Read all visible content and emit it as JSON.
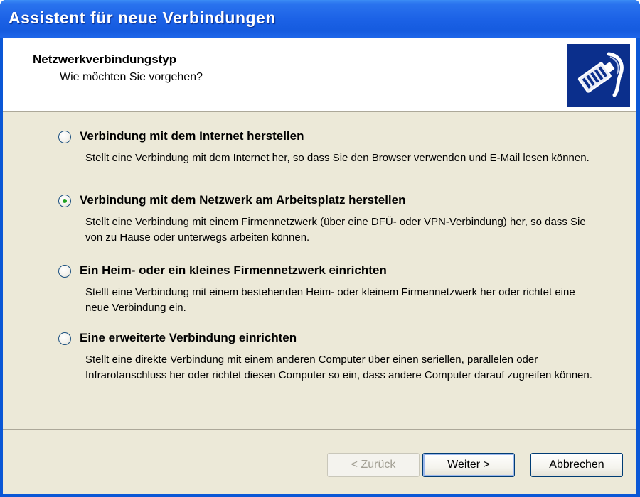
{
  "window": {
    "title": "Assistent für neue Verbindungen"
  },
  "header": {
    "title": "Netzwerkverbindungstyp",
    "subtitle": "Wie möchten Sie vorgehen?",
    "icon": "network-cable-icon"
  },
  "options": [
    {
      "label": "Verbindung mit dem Internet herstellen",
      "description": "Stellt eine Verbindung mit dem Internet her, so dass Sie den Browser verwenden und E-Mail lesen können.",
      "checked": false
    },
    {
      "label": "Verbindung mit dem Netzwerk am Arbeitsplatz herstellen",
      "description": "Stellt eine Verbindung mit einem Firmennetzwerk (über eine DFÜ- oder VPN-Verbindung) her, so dass Sie von zu Hause oder unterwegs arbeiten können.",
      "checked": true
    },
    {
      "label": "Ein Heim- oder ein kleines Firmennetzwerk einrichten",
      "description": "Stellt eine Verbindung mit einem bestehenden Heim- oder kleinem Firmennetzwerk her oder richtet eine neue Verbindung ein.",
      "checked": false
    },
    {
      "label": "Eine erweiterte Verbindung einrichten",
      "description": "Stellt eine direkte Verbindung mit einem anderen Computer über einen seriellen, parallelen oder Infrarotanschluss her oder richtet diesen Computer so ein, dass andere Computer darauf zugreifen können.",
      "checked": false
    }
  ],
  "buttons": {
    "back": "< Zurück",
    "next": "Weiter >",
    "cancel": "Abbrechen"
  },
  "colors": {
    "titlebar": "#1c62e6",
    "client": "#ece9d8",
    "header_icon_bg": "#0b2f8c",
    "radio_dot": "#21a121"
  }
}
